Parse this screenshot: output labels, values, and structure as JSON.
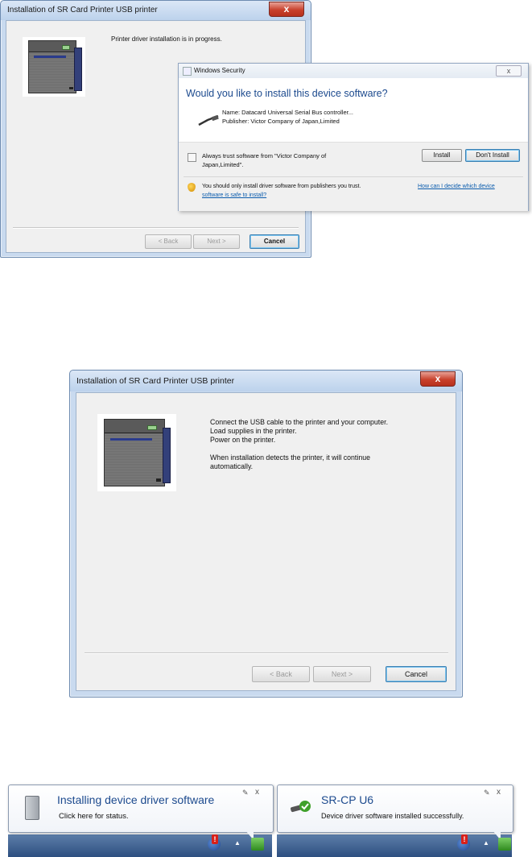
{
  "screen1": {
    "window_title": "Installation of SR Card Printer  USB printer",
    "close_label": "x",
    "progress_text": "Printer driver installation is in progress.",
    "buttons": {
      "back": "< Back",
      "next": "Next >",
      "cancel": "Cancel"
    }
  },
  "security_dialog": {
    "title": "Windows Security",
    "close_label": "x",
    "question": "Would you like to install this device software?",
    "name_line": "Name: Datacard Universal Serial Bus controller...",
    "publisher_line": "Publisher: Victor Company of Japan,Limited",
    "trust_checkbox_label_1": "Always trust software from \"Victor Company of",
    "trust_checkbox_label_2": "Japan,Limited\".",
    "install_button": "Install",
    "dont_install_button": "Don't Install",
    "warning_text": "You should only install driver software from publishers you trust.",
    "help_link_1": "How can I decide which device",
    "help_link_2": "software is safe to install?"
  },
  "screen2": {
    "window_title": "Installation of SR Card Printer  USB printer",
    "close_label": "x",
    "instruction_1": "Connect the USB cable to the printer and your computer.",
    "instruction_2": "Load supplies in the printer.",
    "instruction_3": "Power on the printer.",
    "instruction_4": "When installation detects the printer, it will continue",
    "instruction_5": "automatically.",
    "buttons": {
      "back": "< Back",
      "next": "Next >",
      "cancel": "Cancel"
    }
  },
  "balloon1": {
    "title": "Installing device driver software",
    "text": "Click here for status.",
    "close_label": "x"
  },
  "balloon2": {
    "title": "SR-CP U6",
    "text": "Device driver software installed successfully.",
    "close_label": "x"
  },
  "colors": {
    "accent": "#1c4a8e",
    "close_red": "#c8412c",
    "link": "#0b5cad"
  }
}
